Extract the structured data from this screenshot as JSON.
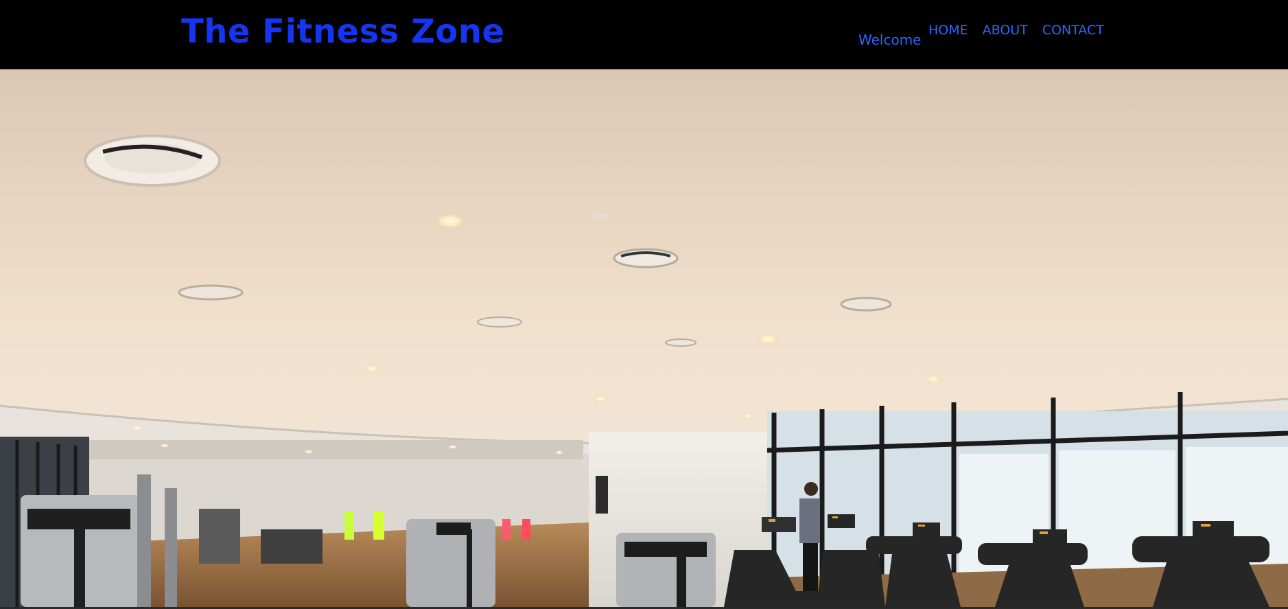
{
  "header": {
    "brand": "The Fitness Zone",
    "welcome": "Welcome",
    "nav": [
      "HOME",
      "ABOUT",
      "CONTACT"
    ]
  },
  "hero": {
    "icon": "gym-photo"
  },
  "colors": {
    "brand": "#1535f0",
    "nav": "#2b67ff",
    "header_bg": "#000000"
  }
}
